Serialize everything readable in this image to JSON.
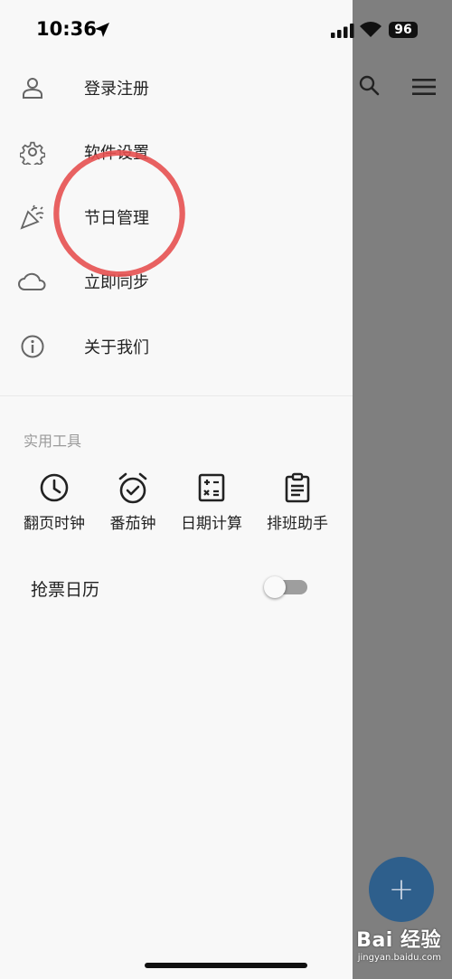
{
  "status_bar": {
    "time": "10:36",
    "battery": "96"
  },
  "menu": {
    "items": [
      {
        "label": "登录注册",
        "icon": "person-icon"
      },
      {
        "label": "软件设置",
        "icon": "gear-icon"
      },
      {
        "label": "节日管理",
        "icon": "party-popper-icon"
      },
      {
        "label": "立即同步",
        "icon": "cloud-icon"
      },
      {
        "label": "关于我们",
        "icon": "info-icon"
      }
    ]
  },
  "tools": {
    "title": "实用工具",
    "items": [
      {
        "label": "翻页时钟",
        "icon": "clock-icon"
      },
      {
        "label": "番茄钟",
        "icon": "alarm-clock-icon"
      },
      {
        "label": "日期计算",
        "icon": "calculator-icon"
      },
      {
        "label": "排班助手",
        "icon": "clipboard-icon"
      }
    ]
  },
  "ticket_calendar": {
    "label": "抢票日历",
    "enabled": false
  },
  "fab": {
    "label": "+"
  },
  "watermark": {
    "logo": "Bai 经验",
    "url": "jingyan.baidu.com"
  },
  "colors": {
    "annotation": "#e65050",
    "fab": "#2e5f8c",
    "backdrop": "#7f7f7f"
  }
}
